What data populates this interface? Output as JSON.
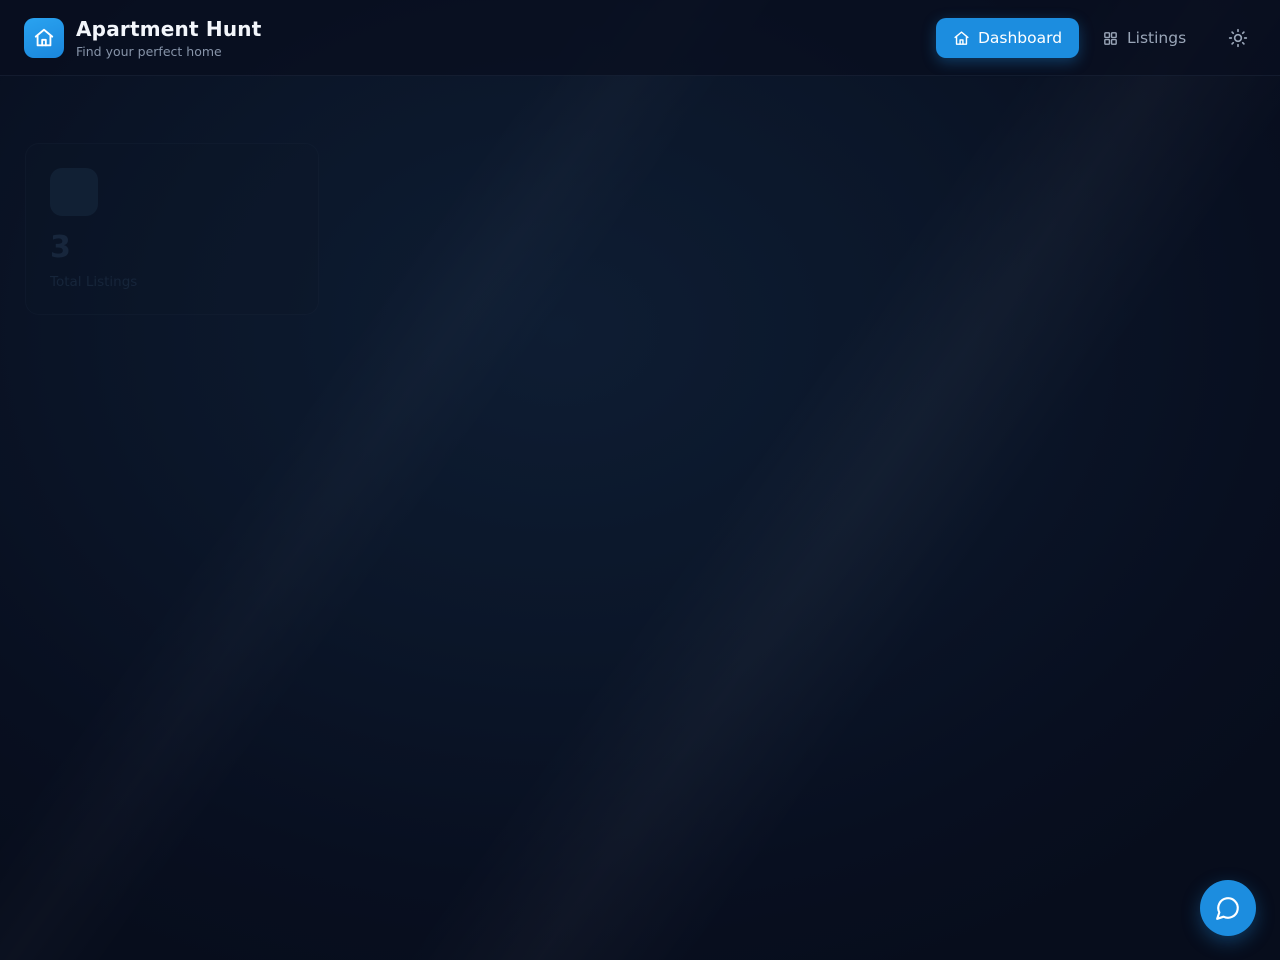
{
  "header": {
    "title": "Apartment Hunt",
    "subtitle": "Find your perfect home",
    "logo_icon": "home-icon"
  },
  "nav": {
    "items": [
      {
        "label": "Dashboard",
        "icon": "home-icon",
        "active": true
      },
      {
        "label": "Listings",
        "icon": "grid-icon",
        "active": false
      }
    ],
    "theme_toggle_icon": "sun-icon"
  },
  "stats": {
    "cards": [
      {
        "value": "3",
        "label": "Total Listings"
      }
    ]
  },
  "chat": {
    "icon": "chat-bubble-icon"
  },
  "colors": {
    "accent": "#1c8ddf",
    "background": "#0b1629",
    "muted_text": "#8693a8"
  }
}
